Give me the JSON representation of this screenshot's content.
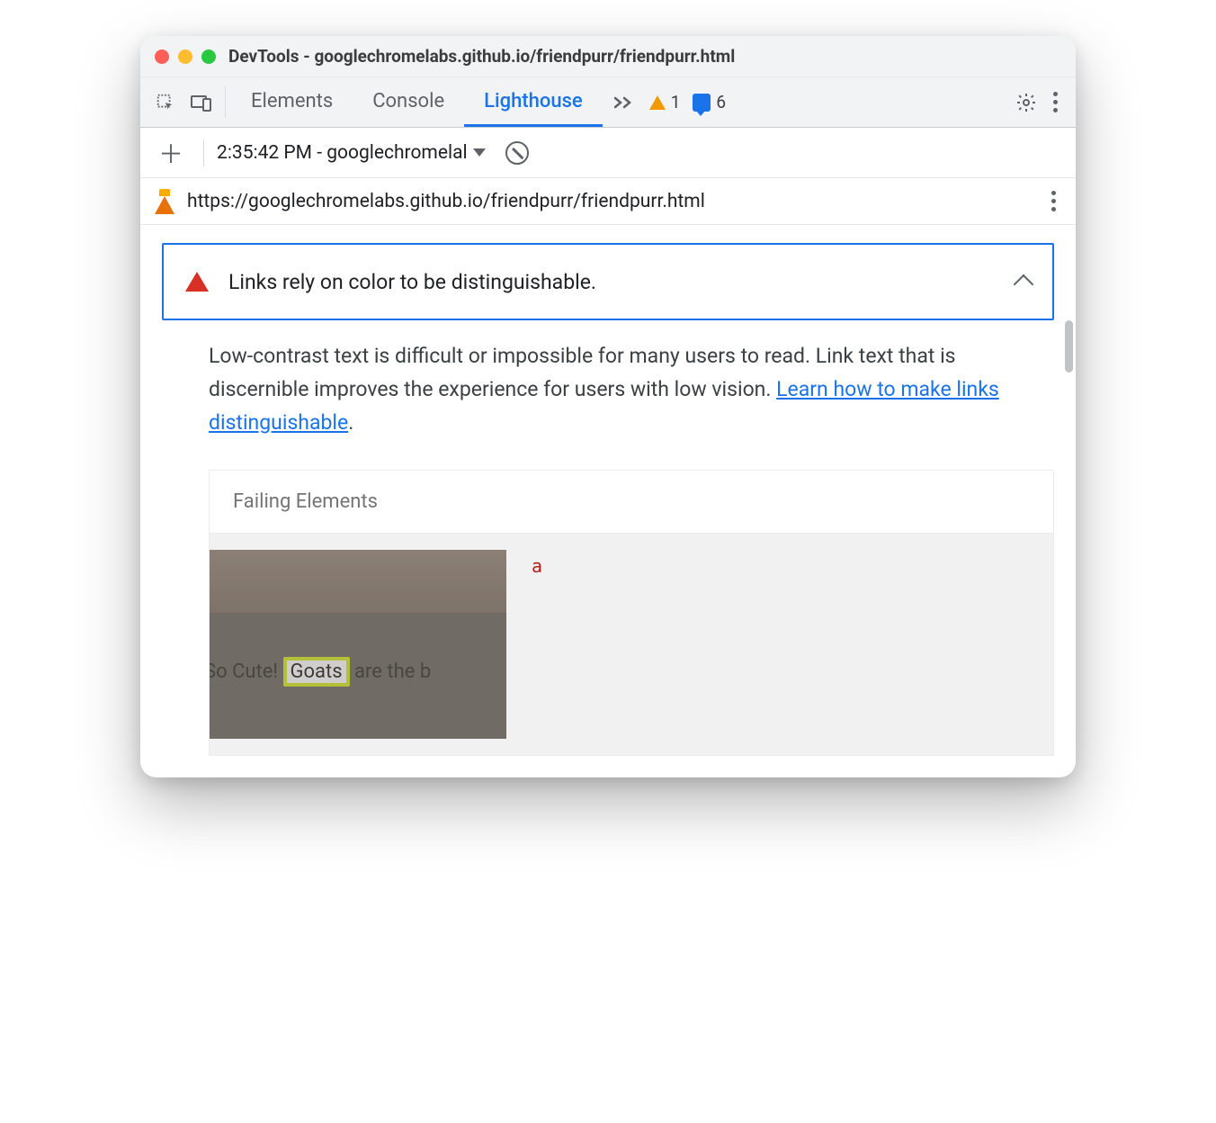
{
  "window": {
    "title": "DevTools - googlechromelabs.github.io/friendpurr/friendpurr.html"
  },
  "tabs": {
    "elements": "Elements",
    "console": "Console",
    "lighthouse": "Lighthouse"
  },
  "status": {
    "warning_count": "1",
    "message_count": "6"
  },
  "report_select": {
    "label": "2:35:42 PM - googlechromelal"
  },
  "url": "https://googlechromelabs.github.io/friendpurr/friendpurr.html",
  "audit": {
    "title": "Links rely on color to be distinguishable.",
    "description_pre": "Low-contrast text is difficult or impossible for many users to read. Link text that is discernible improves the experience for users with low vision. ",
    "learn_link": "Learn how to make links distinguishable",
    "description_post": "."
  },
  "failing": {
    "header": "Failing Elements",
    "element_tag": "a",
    "thumb_text_left": "So Cute! ",
    "thumb_highlight": "Goats",
    "thumb_text_right": " are the b"
  }
}
